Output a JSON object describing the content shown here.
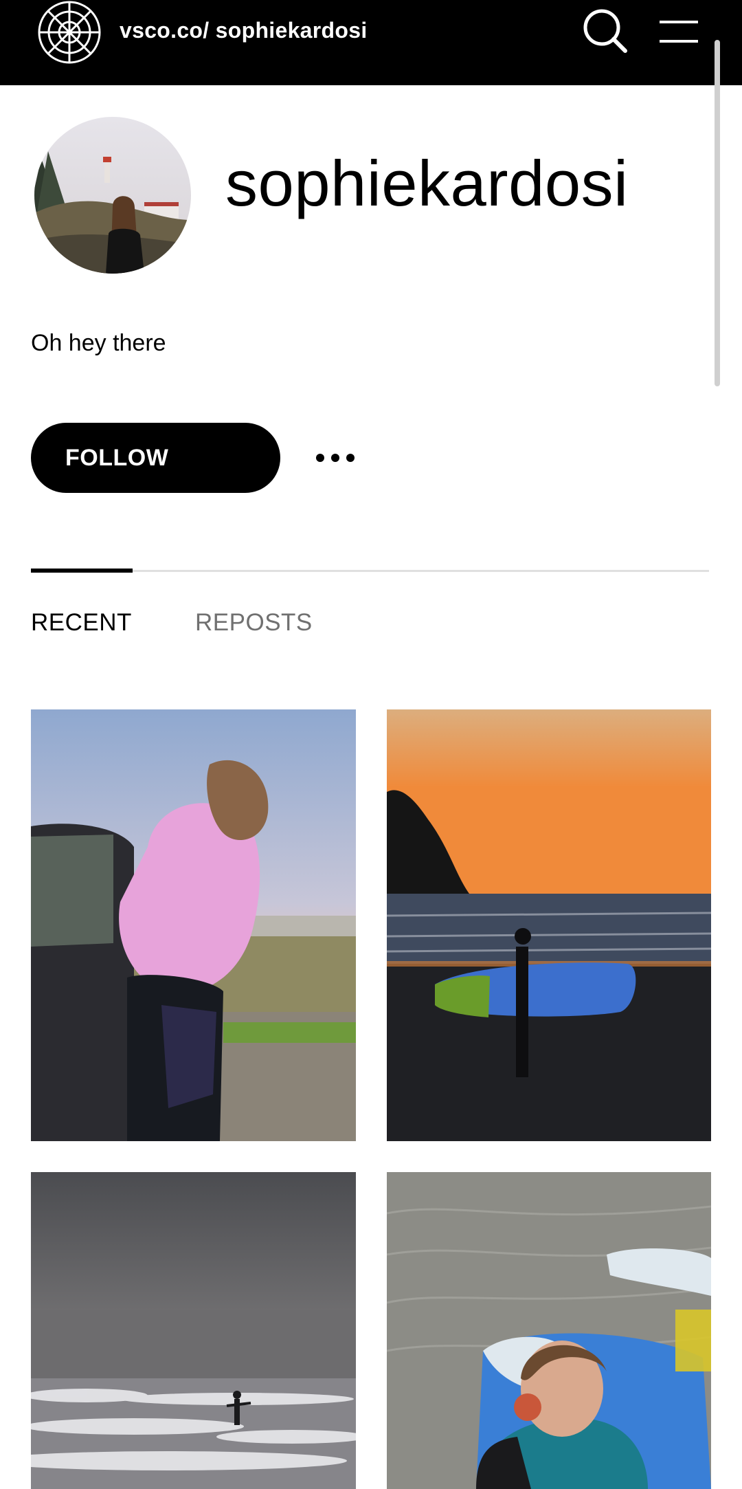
{
  "header": {
    "url_text": "vsco.co/ sophiekardosi",
    "logo_icon": "vsco-logo-icon",
    "search_icon": "search-icon",
    "menu_icon": "hamburger-menu-icon"
  },
  "profile": {
    "username": "sophiekardosi",
    "bio": "Oh hey there",
    "follow_label": "FOLLOW",
    "more_icon": "more-options-icon"
  },
  "tabs": [
    {
      "label": "RECENT",
      "active": true
    },
    {
      "label": "REPOSTS",
      "active": false
    }
  ],
  "grid": {
    "photos": [
      {
        "subject": "girl in pink fleece beside car"
      },
      {
        "subject": "surfer silhouette at sunset"
      },
      {
        "subject": "surfer riding wave"
      },
      {
        "subject": "girl eating apple by surfboards"
      }
    ]
  },
  "colors": {
    "header_bg": "#000000",
    "button_bg": "#000000",
    "inactive_tab": "#707070"
  }
}
